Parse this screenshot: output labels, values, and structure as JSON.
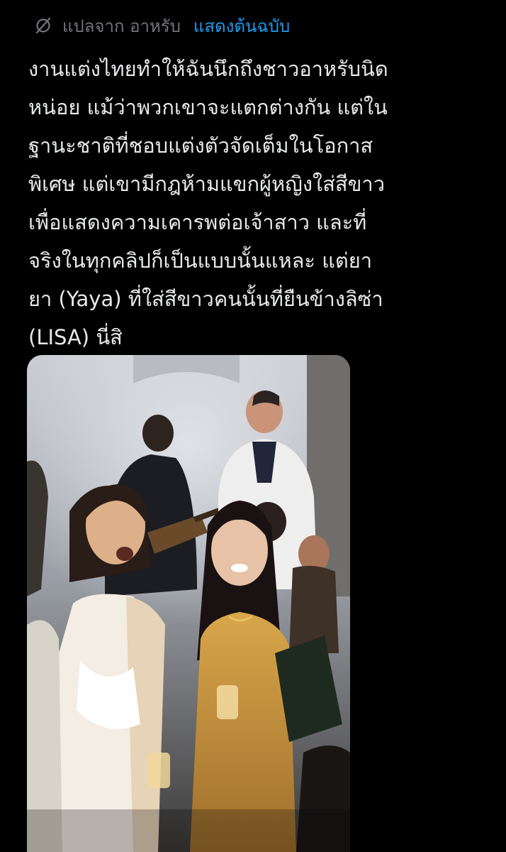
{
  "translation": {
    "label": "แปลจาก อาหรับ",
    "show_original": "แสดงต้นฉบับ"
  },
  "tweet": {
    "text": "งานแต่งไทยทำให้ฉันนึกถึงชาวอาหรับนิด\nหน่อย แม้ว่าพวกเขาจะแตกต่างกัน แต่ใน\nฐานะชาติที่ชอบแต่งตัวจัดเต็มในโอกาส\nพิเศษ แต่เขามีกฎห้ามแขกผู้หญิงใส่สีขาว\nเพื่อแสดงความเคารพต่อเจ้าสาว และที่\nจริงในทุกคลิปก็เป็นแบบนั้นแหละ แต่ยา\nยา (Yaya) ที่ใส่สีขาวคนนั้นที่ยืนข้างลิซ่า\n(LISA) นี่สิ"
  },
  "colors": {
    "background": "#000000",
    "text": "#e7e9ea",
    "muted": "#71767b",
    "link": "#1d9bf0"
  },
  "icons": {
    "translate": "globe-slash-icon"
  }
}
